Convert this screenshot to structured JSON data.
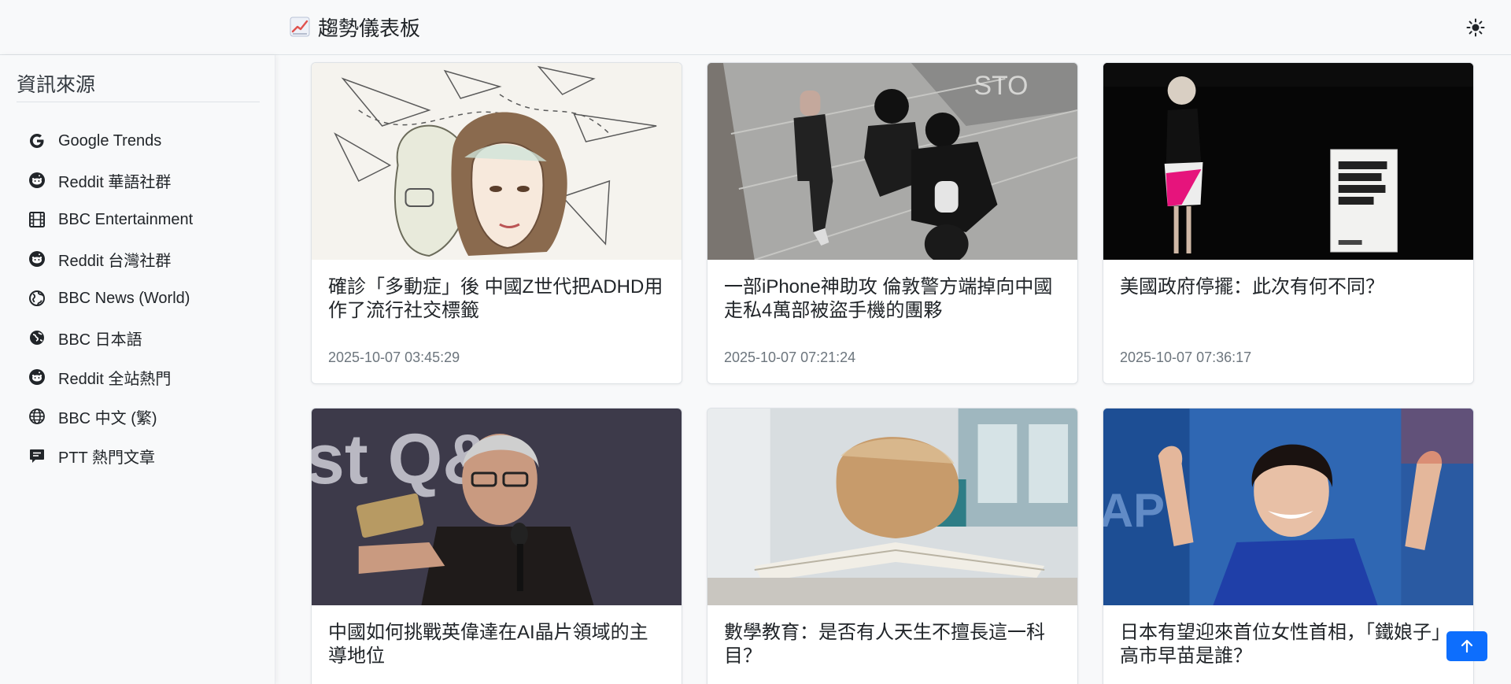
{
  "header": {
    "title": "趨勢儀表板",
    "brand_icon": "chart-increasing-icon",
    "theme_icon": "sun-icon"
  },
  "sidebar": {
    "title": "資訊來源",
    "items": [
      {
        "label": "Google Trends",
        "icon": "google-icon"
      },
      {
        "label": "Reddit 華語社群",
        "icon": "reddit-icon"
      },
      {
        "label": "BBC Entertainment",
        "icon": "film-icon"
      },
      {
        "label": "Reddit 台灣社群",
        "icon": "reddit-icon"
      },
      {
        "label": "BBC News (World)",
        "icon": "globe-americas-icon"
      },
      {
        "label": "BBC 日本語",
        "icon": "globe-asia-icon"
      },
      {
        "label": "Reddit 全站熱門",
        "icon": "reddit-icon"
      },
      {
        "label": "BBC 中文 (繁)",
        "icon": "globe-icon"
      },
      {
        "label": "PTT 熱門文章",
        "icon": "chat-square-text-icon"
      }
    ]
  },
  "cards": [
    {
      "title": "確診「多動症」後 中國Z世代把ADHD用作了流行社交標籤",
      "date": "2025-10-07 03:45:29"
    },
    {
      "title": "一部iPhone神助攻 倫敦警方端掉向中國走私4萬部被盜手機的團夥",
      "date": "2025-10-07 07:21:24"
    },
    {
      "title": "美國政府停擺：此次有何不同？",
      "date": "2025-10-07 07:36:17"
    },
    {
      "title": "中國如何挑戰英偉達在AI晶片領域的主導地位",
      "date": ""
    },
    {
      "title": "數學教育：是否有人天生不擅長這一科目？",
      "date": ""
    },
    {
      "title": "日本有望迎來首位女性首相，「鐵娘子」高市早苗是誰？",
      "date": ""
    }
  ],
  "scroll_top_icon": "arrow-up-icon",
  "colors": {
    "accent": "#0d6efd",
    "background": "#f8f9fa",
    "muted_text": "#6c757d"
  }
}
